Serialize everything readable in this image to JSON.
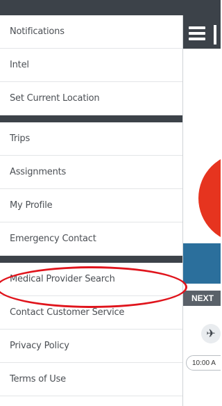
{
  "menu": {
    "group1": [
      {
        "label": "Notifications"
      },
      {
        "label": "Intel"
      },
      {
        "label": "Set Current Location"
      }
    ],
    "group2": [
      {
        "label": "Trips"
      },
      {
        "label": "Assignments"
      },
      {
        "label": "My Profile"
      },
      {
        "label": "Emergency Contact"
      }
    ],
    "group3": [
      {
        "label": "Medical Provider Search"
      },
      {
        "label": "Contact Customer Service"
      },
      {
        "label": "Privacy Policy"
      },
      {
        "label": "Terms of Use"
      }
    ]
  },
  "background": {
    "next_label": "NEXT",
    "time_label": "10:00 A"
  },
  "icons": {
    "hamburger": "menu-icon",
    "plane": "airplane-icon"
  },
  "colors": {
    "header": "#3c4249",
    "annotation": "#e0141c",
    "red_graphic": "#e6341f",
    "blue_band": "#2b6f9c"
  }
}
